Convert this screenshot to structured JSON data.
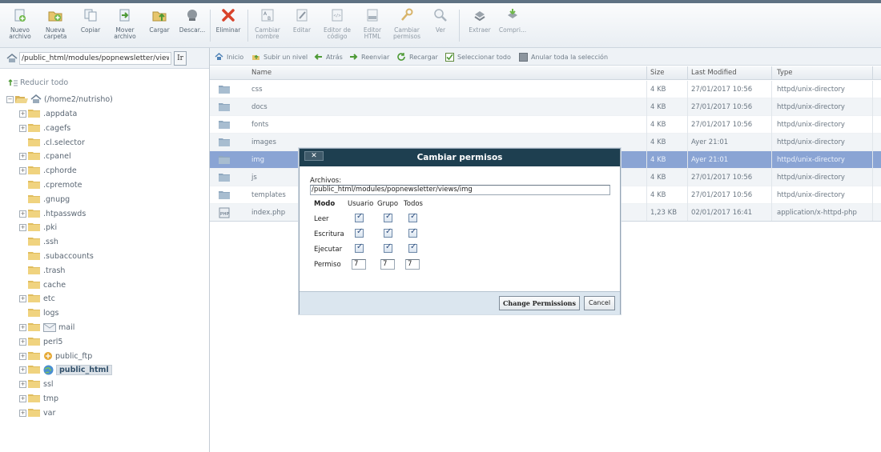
{
  "toolbar": {
    "buttons": [
      {
        "label": "Nuevo\narchivo",
        "icon": "new-file-icon"
      },
      {
        "label": "Nueva\ncarpeta",
        "icon": "new-folder-icon"
      },
      {
        "label": "Copiar",
        "icon": "copy-icon"
      },
      {
        "label": "Mover\narchivo",
        "icon": "move-icon"
      },
      {
        "label": "Cargar",
        "icon": "upload-icon"
      },
      {
        "label": "Descar...",
        "icon": "download-icon"
      },
      {
        "label": "Eliminar",
        "icon": "delete-icon"
      },
      {
        "label": "Cambiar\nnombre",
        "icon": "rename-icon"
      },
      {
        "label": "Editar",
        "icon": "edit-icon"
      },
      {
        "label": "Editor de\ncódigo",
        "icon": "code-editor-icon"
      },
      {
        "label": "Editor\nHTML",
        "icon": "html-editor-icon"
      },
      {
        "label": "Cambiar\npermisos",
        "icon": "permissions-icon"
      },
      {
        "label": "Ver",
        "icon": "view-icon"
      },
      {
        "label": "Extraer",
        "icon": "extract-icon"
      },
      {
        "label": "Compri...",
        "icon": "compress-icon"
      }
    ]
  },
  "path": {
    "value": "/public_html/modules/popnewsletter/views",
    "go_label": "Ir"
  },
  "nav": {
    "home": "Inicio",
    "up": "Subir un nivel",
    "back": "Atrás",
    "forward": "Reenviar",
    "reload": "Recargar",
    "select_all": "Seleccionar todo",
    "unselect_all": "Anular toda la selección"
  },
  "tree": {
    "collapse_all": "Reducir todo",
    "root": "(/home2/nutrisho)",
    "items": [
      {
        "label": ".appdata",
        "expandable": true
      },
      {
        "label": ".cagefs",
        "expandable": true
      },
      {
        "label": ".cl.selector",
        "expandable": false
      },
      {
        "label": ".cpanel",
        "expandable": true
      },
      {
        "label": ".cphorde",
        "expandable": true
      },
      {
        "label": ".cpremote",
        "expandable": false
      },
      {
        "label": ".gnupg",
        "expandable": false
      },
      {
        "label": ".htpasswds",
        "expandable": true
      },
      {
        "label": ".pki",
        "expandable": true
      },
      {
        "label": ".ssh",
        "expandable": false
      },
      {
        "label": ".subaccounts",
        "expandable": false
      },
      {
        "label": ".trash",
        "expandable": false
      },
      {
        "label": "cache",
        "expandable": false
      },
      {
        "label": "etc",
        "expandable": true
      },
      {
        "label": "logs",
        "expandable": false
      },
      {
        "label": "mail",
        "expandable": true
      },
      {
        "label": "perl5",
        "expandable": true
      },
      {
        "label": "public_ftp",
        "expandable": true
      },
      {
        "label": "public_html",
        "expandable": true
      },
      {
        "label": "ssl",
        "expandable": true
      },
      {
        "label": "tmp",
        "expandable": true
      },
      {
        "label": "var",
        "expandable": true
      }
    ]
  },
  "list": {
    "columns": [
      "Name",
      "Size",
      "Last Modified",
      "Type"
    ],
    "rows": [
      {
        "name": "css",
        "size": "4 KB",
        "modified": "27/01/2017 10:56",
        "type": "httpd/unix-directory",
        "icon": "folder-icon"
      },
      {
        "name": "docs",
        "size": "4 KB",
        "modified": "27/01/2017 10:56",
        "type": "httpd/unix-directory",
        "icon": "folder-icon"
      },
      {
        "name": "fonts",
        "size": "4 KB",
        "modified": "27/01/2017 10:56",
        "type": "httpd/unix-directory",
        "icon": "folder-icon"
      },
      {
        "name": "images",
        "size": "4 KB",
        "modified": "Ayer 21:01",
        "type": "httpd/unix-directory",
        "icon": "folder-icon"
      },
      {
        "name": "img",
        "size": "4 KB",
        "modified": "Ayer 21:01",
        "type": "httpd/unix-directory",
        "icon": "folder-icon"
      },
      {
        "name": "js",
        "size": "4 KB",
        "modified": "27/01/2017 10:56",
        "type": "httpd/unix-directory",
        "icon": "folder-icon"
      },
      {
        "name": "templates",
        "size": "4 KB",
        "modified": "27/01/2017 10:56",
        "type": "httpd/unix-directory",
        "icon": "folder-icon"
      },
      {
        "name": "index.php",
        "size": "1,23 KB",
        "modified": "02/01/2017 16:41",
        "type": "application/x-httpd-php",
        "icon": "php-file-icon"
      }
    ]
  },
  "dialog": {
    "title": "Cambiar permisos",
    "close_label": "✕",
    "files_label": "Archivos:",
    "files_value": "/public_html/modules/popnewsletter/views/img",
    "mode_label": "Modo",
    "col_user": "Usuario",
    "col_group": "Grupo",
    "col_all": "Todos",
    "row_read": "Leer",
    "row_write": "Escritura",
    "row_exec": "Ejecutar",
    "row_perm": "Permiso",
    "perm_user": "7",
    "perm_group": "7",
    "perm_all": "7",
    "change_button": "Change Permissions",
    "cancel_button": "Cancel"
  }
}
